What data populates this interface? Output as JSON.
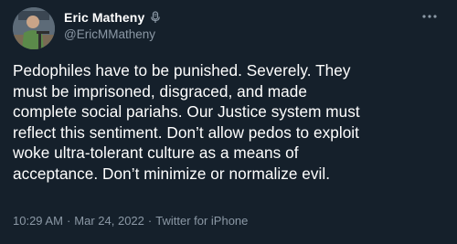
{
  "tweet": {
    "display_name": "Eric Matheny",
    "handle": "@EricMMatheny",
    "text": "Pedophiles have to be punished. Severely. They\nmust be imprisoned, disgraced, and made\ncomplete social pariahs. Our Justice system must\nreflect this sentiment. Don’t allow pedos to exploit\nwoke ultra-tolerant culture as a means of\nacceptance. Don’t minimize or normalize evil.",
    "time": "10:29 AM",
    "separator": "·",
    "date": "Mar 24, 2022",
    "source": "Twitter for iPhone"
  },
  "icons": {
    "badge": "microphone-icon",
    "more": "more-dots-icon"
  },
  "colors": {
    "background": "#15202b",
    "primary_text": "#ffffff",
    "secondary_text": "#8b98a5"
  }
}
